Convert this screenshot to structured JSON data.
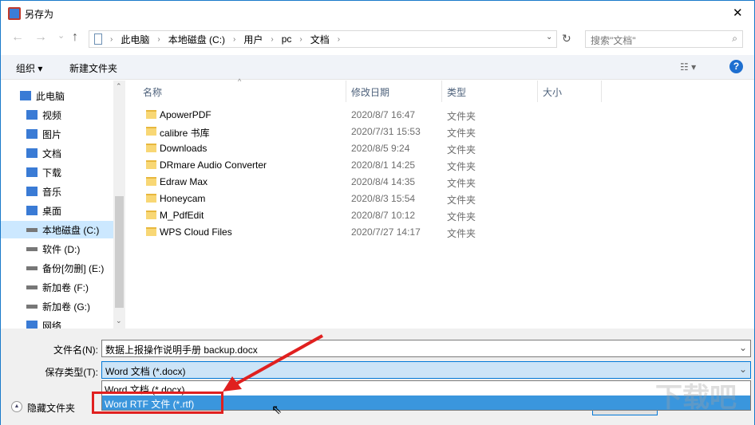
{
  "window": {
    "title": "另存为",
    "close": "✕"
  },
  "nav": {
    "back": "←",
    "forward": "→",
    "recent": "⌄",
    "up": "↑",
    "breadcrumb": [
      "此电脑",
      "本地磁盘 (C:)",
      "用户",
      "pc",
      "文档"
    ],
    "refresh": "↻",
    "search_placeholder": "搜索\"文档\""
  },
  "toolbar": {
    "organize": "组织 ▾",
    "new_folder": "新建文件夹",
    "help": "?"
  },
  "sidebar": {
    "items": [
      {
        "label": "此电脑",
        "icon": "computer-icon"
      },
      {
        "label": "视频",
        "icon": "video-icon"
      },
      {
        "label": "图片",
        "icon": "picture-icon"
      },
      {
        "label": "文档",
        "icon": "document-icon"
      },
      {
        "label": "下载",
        "icon": "download-icon"
      },
      {
        "label": "音乐",
        "icon": "music-icon"
      },
      {
        "label": "桌面",
        "icon": "desktop-icon"
      },
      {
        "label": "本地磁盘 (C:)",
        "icon": "drive-icon",
        "selected": true
      },
      {
        "label": "软件 (D:)",
        "icon": "drive-icon"
      },
      {
        "label": "备份[勿删] (E:)",
        "icon": "drive-icon"
      },
      {
        "label": "新加卷 (F:)",
        "icon": "drive-icon"
      },
      {
        "label": "新加卷 (G:)",
        "icon": "drive-icon"
      },
      {
        "label": "网络",
        "icon": "network-icon"
      }
    ]
  },
  "columns": {
    "name": "名称",
    "date": "修改日期",
    "type": "类型",
    "size": "大小"
  },
  "files": [
    {
      "name": "ApowerPDF",
      "date": "2020/8/7 16:47",
      "type": "文件夹"
    },
    {
      "name": "calibre 书库",
      "date": "2020/7/31 15:53",
      "type": "文件夹"
    },
    {
      "name": "Downloads",
      "date": "2020/8/5 9:24",
      "type": "文件夹"
    },
    {
      "name": "DRmare Audio Converter",
      "date": "2020/8/1 14:25",
      "type": "文件夹"
    },
    {
      "name": "Edraw Max",
      "date": "2020/8/4 14:35",
      "type": "文件夹"
    },
    {
      "name": "Honeycam",
      "date": "2020/8/3 15:54",
      "type": "文件夹"
    },
    {
      "name": "M_PdfEdit",
      "date": "2020/8/7 10:12",
      "type": "文件夹"
    },
    {
      "name": "WPS Cloud Files",
      "date": "2020/7/27 14:17",
      "type": "文件夹"
    }
  ],
  "bottom": {
    "filename_label": "文件名(N):",
    "filename": "数据上报操作说明手册 backup.docx",
    "type_label": "保存类型(T):",
    "type_value": "Word 文档 (*.docx)",
    "options": [
      "Word 文档 (*.docx)",
      "Word RTF 文件 (*.rtf)"
    ],
    "hide_folders": "隐藏文件夹"
  },
  "watermark": "下载吧 www.xiazaiba.com",
  "colors": {
    "accent": "#3a96dd",
    "annotation": "#e0201f"
  }
}
